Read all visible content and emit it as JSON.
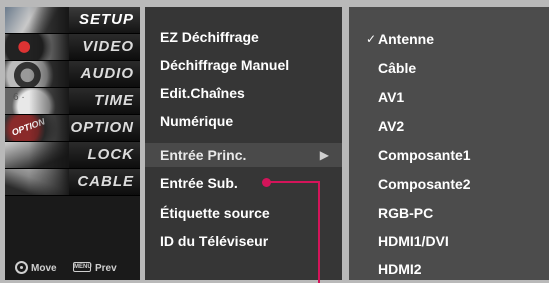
{
  "categories": [
    {
      "label": "SETUP",
      "icon": "satellite-dish-icon"
    },
    {
      "label": "VIDEO",
      "icon": "film-reel-icon"
    },
    {
      "label": "AUDIO",
      "icon": "speaker-icon"
    },
    {
      "label": "TIME",
      "icon": "clock-icon"
    },
    {
      "label": "OPTION",
      "icon": "option-icon"
    },
    {
      "label": "LOCK",
      "icon": "padlock-icon"
    },
    {
      "label": "CABLE",
      "icon": "cable-icon"
    }
  ],
  "legend": {
    "move_label": "Move",
    "menu_key": "MENU",
    "prev_label": "Prev"
  },
  "submenu": [
    {
      "label": "EZ Déchiffrage"
    },
    {
      "label": "Déchiffrage Manuel"
    },
    {
      "label": "Edit.Chaînes"
    },
    {
      "label": "Numérique"
    },
    {
      "label": "Entrée Princ.",
      "arrow": "▶"
    },
    {
      "label": "Entrée Sub."
    },
    {
      "label": "Étiquette source"
    },
    {
      "label": "ID du Téléviseur"
    }
  ],
  "options": [
    {
      "label": "Antenne",
      "check": "✓"
    },
    {
      "label": "Câble"
    },
    {
      "label": "AV1"
    },
    {
      "label": "AV2"
    },
    {
      "label": "Composante1"
    },
    {
      "label": "Composante2"
    },
    {
      "label": "RGB-PC"
    },
    {
      "label": "HDMI1/DVI"
    },
    {
      "label": "HDMI2"
    }
  ],
  "colors": {
    "callout": "#d4145a",
    "submenu_bg": "#363636",
    "options_bg": "#4c4c4c"
  }
}
